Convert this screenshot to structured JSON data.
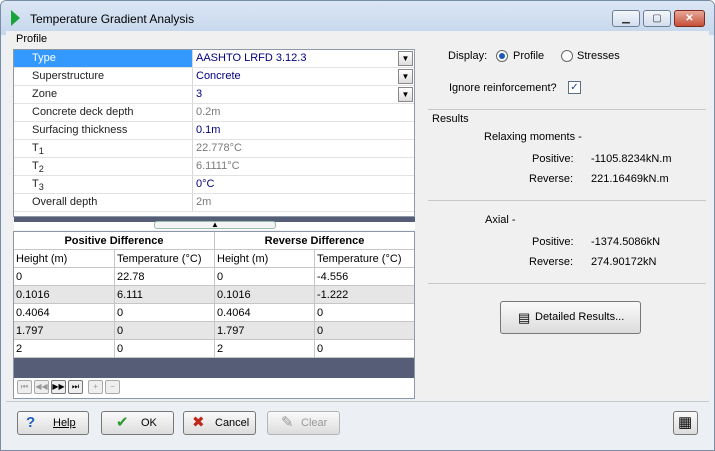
{
  "window": {
    "title": "Temperature Gradient Analysis",
    "minimize": "▁",
    "maximize": "▢",
    "close": "✕"
  },
  "profile": {
    "group_label": "Profile",
    "properties": [
      {
        "name": "Type",
        "value": "AASHTO LRFD 3.12.3"
      },
      {
        "name": "Superstructure",
        "value": "Concrete"
      },
      {
        "name": "Zone",
        "value": "3"
      },
      {
        "name": "Concrete deck depth",
        "value": "0.2m"
      },
      {
        "name": "Surfacing thickness",
        "value": "0.1m"
      },
      {
        "name": "T",
        "sub": "1",
        "value": "22.778°C"
      },
      {
        "name": "T",
        "sub": "2",
        "value": "6.1111°C"
      },
      {
        "name": "T",
        "sub": "3",
        "value": "0°C"
      },
      {
        "name": "Overall depth",
        "value": "2m"
      }
    ],
    "dropdown_arrow": "▼",
    "splitter_glyph": "▲"
  },
  "grid": {
    "positive_header": "Positive Difference",
    "reverse_header": "Reverse Difference",
    "columns": [
      "Height (m)",
      "Temperature (°C)",
      "Height (m)",
      "Temperature (°C)"
    ],
    "rows": [
      [
        "0",
        "22.78",
        "0",
        "-4.556"
      ],
      [
        "0.1016",
        "6.111",
        "0.1016",
        "-1.222"
      ],
      [
        "0.4064",
        "0",
        "0.4064",
        "0"
      ],
      [
        "1.797",
        "0",
        "1.797",
        "0"
      ],
      [
        "2",
        "0",
        "2",
        "0"
      ]
    ],
    "nav": [
      "⏮",
      "◀◀",
      "▶▶",
      "⏭",
      "+",
      "−"
    ]
  },
  "display": {
    "label": "Display:",
    "option_profile": "Profile",
    "option_stresses": "Stresses",
    "selected": "Profile"
  },
  "ignore_reinforcement": {
    "label": "Ignore reinforcement?",
    "checked": true,
    "mark": "✓"
  },
  "results": {
    "group_label": "Results",
    "relaxing_label": "Relaxing moments -",
    "rm_positive_label": "Positive:",
    "rm_positive_value": "-1105.8234kN.m",
    "rm_reverse_label": "Reverse:",
    "rm_reverse_value": "221.16469kN.m",
    "axial_label": "Axial -",
    "ax_positive_label": "Positive:",
    "ax_positive_value": "-1374.5086kN",
    "ax_reverse_label": "Reverse:",
    "ax_reverse_value": "274.90172kN",
    "detailed_button": "Detailed Results..."
  },
  "buttons": {
    "help": "Help",
    "ok": "OK",
    "cancel": "Cancel",
    "clear": "Clear"
  },
  "icons": {
    "help": "?",
    "ok": "✔",
    "cancel": "✖",
    "clear": "✎",
    "detailed": "▤",
    "calculator": "▦"
  }
}
